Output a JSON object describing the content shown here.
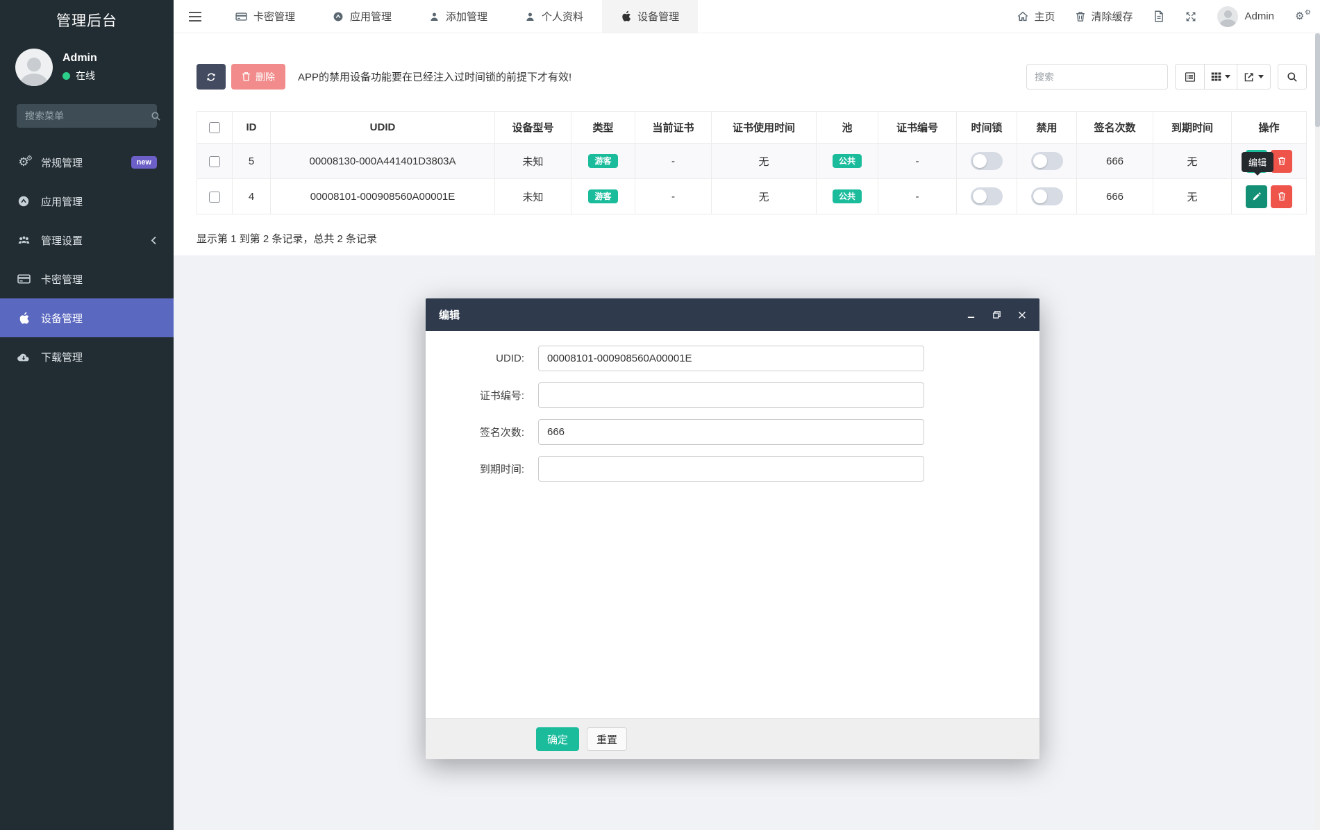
{
  "sidebar": {
    "title": "管理后台",
    "user": {
      "name": "Admin",
      "status": "在线"
    },
    "search_placeholder": "搜索菜单",
    "items": [
      {
        "label": "常规管理",
        "icon": "gears-icon",
        "badge": "new"
      },
      {
        "label": "应用管理",
        "icon": "app-circle-icon"
      },
      {
        "label": "管理设置",
        "icon": "users-icon"
      },
      {
        "label": "卡密管理",
        "icon": "credit-card-icon"
      },
      {
        "label": "设备管理",
        "icon": "apple-icon"
      },
      {
        "label": "下载管理",
        "icon": "cloud-download-icon"
      }
    ]
  },
  "navbar": {
    "tabs": [
      {
        "label": "卡密管理",
        "icon": "credit-card-icon"
      },
      {
        "label": "应用管理",
        "icon": "app-circle-icon"
      },
      {
        "label": "添加管理",
        "icon": "user-icon"
      },
      {
        "label": "个人资料",
        "icon": "user-icon"
      },
      {
        "label": "设备管理",
        "icon": "apple-icon"
      }
    ],
    "right": {
      "home": "主页",
      "clear_cache": "清除缓存",
      "user": "Admin"
    }
  },
  "toolbar": {
    "delete_label": "删除",
    "warning": "APP的禁用设备功能要在已经注入过时间锁的前提下才有效!",
    "search_placeholder": "搜索"
  },
  "table": {
    "columns": [
      "ID",
      "UDID",
      "设备型号",
      "类型",
      "当前证书",
      "证书使用时间",
      "池",
      "证书编号",
      "时间锁",
      "禁用",
      "签名次数",
      "到期时间",
      "操作"
    ],
    "rows": [
      {
        "id": "5",
        "udid": "00008130-000A441401D3803A",
        "model": "未知",
        "type": "游客",
        "cert": "-",
        "cert_time": "无",
        "pool": "公共",
        "cert_no": "-",
        "sign_count": "666",
        "expire": "无"
      },
      {
        "id": "4",
        "udid": "00008101-000908560A00001E",
        "model": "未知",
        "type": "游客",
        "cert": "-",
        "cert_time": "无",
        "pool": "公共",
        "cert_no": "-",
        "sign_count": "666",
        "expire": "无"
      }
    ],
    "summary": "显示第 1 到第 2 条记录，总共 2 条记录"
  },
  "tooltip": {
    "label": "编辑"
  },
  "modal": {
    "title": "编辑",
    "fields": [
      {
        "label": "UDID:",
        "value": "00008101-000908560A00001E"
      },
      {
        "label": "证书编号:",
        "value": ""
      },
      {
        "label": "签名次数:",
        "value": "666"
      },
      {
        "label": "到期时间:",
        "value": ""
      }
    ],
    "confirm_label": "确定",
    "reset_label": "重置"
  },
  "colors": {
    "accent_teal": "#1abc9c",
    "active_blue": "#5a68c0",
    "badge_purple": "#6c5fc7",
    "danger_red": "#ee544a",
    "danger_soft": "#f28b8b",
    "sidebar_bg": "#222d33",
    "modal_header_bg": "#2f3b4d",
    "online_green": "#2dce89"
  }
}
